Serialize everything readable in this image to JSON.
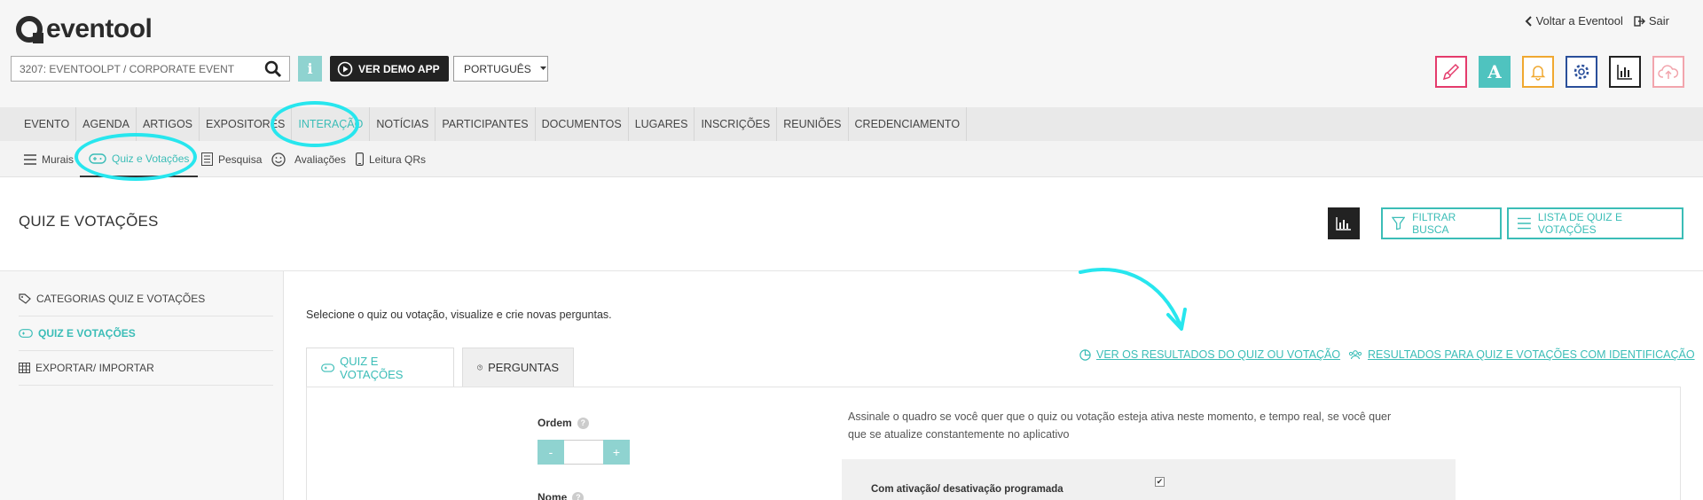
{
  "brand": {
    "name": "eventool"
  },
  "top_links": {
    "back": "Voltar a Eventool",
    "logout": "Sair"
  },
  "event_selector": {
    "value": "3207: EVENTOOLPT / CORPORATE EVENT"
  },
  "demo_button": "VER DEMO APP",
  "language": "PORTUGUÊS",
  "main_nav": [
    "EVENTO",
    "AGENDA",
    "ARTIGOS",
    "EXPOSITORES",
    "INTERAÇÃO",
    "NOTÍCIAS",
    "PARTICIPANTES",
    "DOCUMENTOS",
    "LUGARES",
    "INSCRIÇÕES",
    "REUNIÕES",
    "CREDENCIAMENTO"
  ],
  "sub_nav": {
    "murais": "Murais",
    "quiz": "Quiz e Votações",
    "pesquisa": "Pesquisa",
    "avaliacoes": "Avaliações",
    "leitura": "Leitura QRs"
  },
  "page": {
    "title": "QUIZ E VOTAÇÕES",
    "filter_button": "FILTRAR BUSCA",
    "list_button": "LISTA DE QUIZ E VOTAÇÕES"
  },
  "sidebar": {
    "items": [
      "CATEGORIAS QUIZ E VOTAÇÕES",
      "QUIZ E VOTAÇÕES",
      "EXPORTAR/ IMPORTAR"
    ]
  },
  "content": {
    "intro": "Selecione o quiz ou votação, visualize e crie novas perguntas.",
    "tabs": [
      "QUIZ E VOTAÇÕES",
      "PERGUNTAS"
    ],
    "link_results": "VER OS RESULTADOS DO QUIZ OU VOTAÇÃO",
    "link_results_id": "RESULTADOS PARA QUIZ E VOTAÇÕES COM IDENTIFICAÇÃO",
    "order_label": "Ordem",
    "name_label": "Nome",
    "minus": "-",
    "plus": "+",
    "description": "Assinale o quadro se você quer que o quiz ou votação esteja ativa neste momento, e tempo real, se você quer que se atualize constantemente no aplicativo",
    "scheduled_label": "Com ativação/ desativação programada",
    "checkmark": "✔"
  },
  "icon_buttons": {
    "theme": "A"
  },
  "colors": {
    "accent": "#3bbdb7",
    "annotation": "#27e6ee"
  }
}
